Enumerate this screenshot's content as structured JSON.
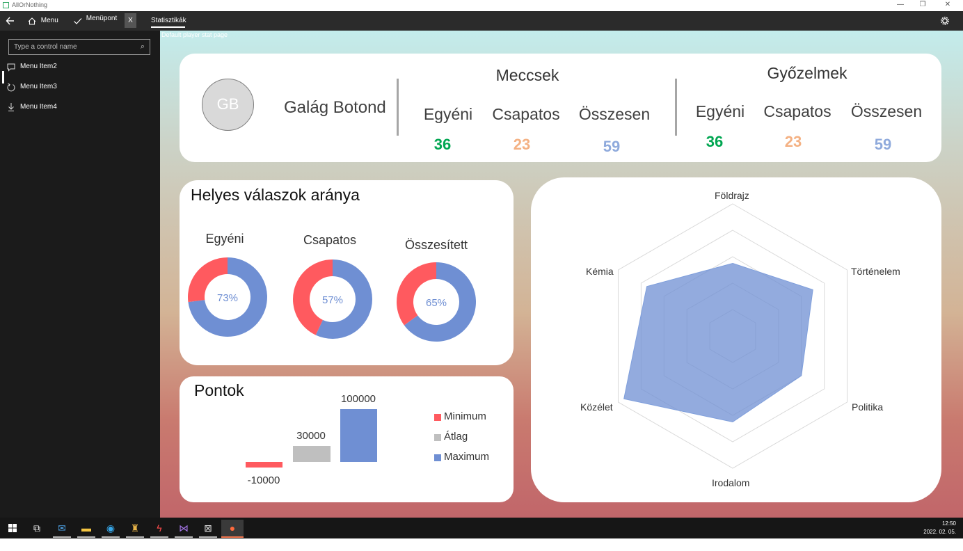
{
  "window": {
    "title": "AllOrNothing"
  },
  "command_bar": {
    "back_icon": "arrow-left-icon",
    "menu_label": "Menu",
    "menupont_label": "Menüpont",
    "close_label": "X",
    "tab_label": "Statisztikák",
    "settings_icon": "gear-icon"
  },
  "sidebar": {
    "search_placeholder": "Type a control name",
    "items": [
      {
        "label": "Menu Item2",
        "icon": "chat-icon"
      },
      {
        "label": "Menu Item3",
        "icon": "refresh-icon"
      },
      {
        "label": "Menu Item4",
        "icon": "download-icon"
      }
    ]
  },
  "page": {
    "subtitle": "Default player stat page"
  },
  "player": {
    "initials": "GB",
    "name": "Galág Botond"
  },
  "meccsek": {
    "title": "Meccsek",
    "labels": [
      "Egyéni",
      "Csapatos",
      "Összesen"
    ],
    "values": [
      "36",
      "23",
      "59"
    ]
  },
  "gyozelmek": {
    "title": "Győzelmek",
    "labels": [
      "Egyéni",
      "Csapatos",
      "Összesen"
    ],
    "values": [
      "36",
      "23",
      "59"
    ]
  },
  "colors": {
    "red": "#ff5a5f",
    "blue": "#6f8fd3",
    "gray": "#bfbfbf",
    "green": "#00a651",
    "orange": "#f4b183",
    "lightblue": "#8faadc"
  },
  "chart_data": [
    {
      "type": "pie",
      "title": "Helyes válaszok aránya",
      "charts": [
        {
          "name": "Egyéni",
          "value": 73,
          "label": "73%"
        },
        {
          "name": "Csapatos",
          "value": 57,
          "label": "57%"
        },
        {
          "name": "Összesített",
          "value": 65,
          "label": "65%"
        }
      ]
    },
    {
      "type": "bar",
      "title": "Pontok",
      "categories": [
        "Minimum",
        "Átlag",
        "Maximum"
      ],
      "values": [
        -10000,
        30000,
        100000
      ],
      "labels": [
        "-10000",
        "30000",
        "100000"
      ]
    },
    {
      "type": "radar",
      "categories": [
        "Földrajz",
        "Történelem",
        "Politika",
        "Irodalom",
        "Közélet",
        "Kémia"
      ],
      "values": [
        55,
        70,
        60,
        65,
        95,
        75
      ],
      "rmax": 100,
      "rings": 5
    }
  ]
}
